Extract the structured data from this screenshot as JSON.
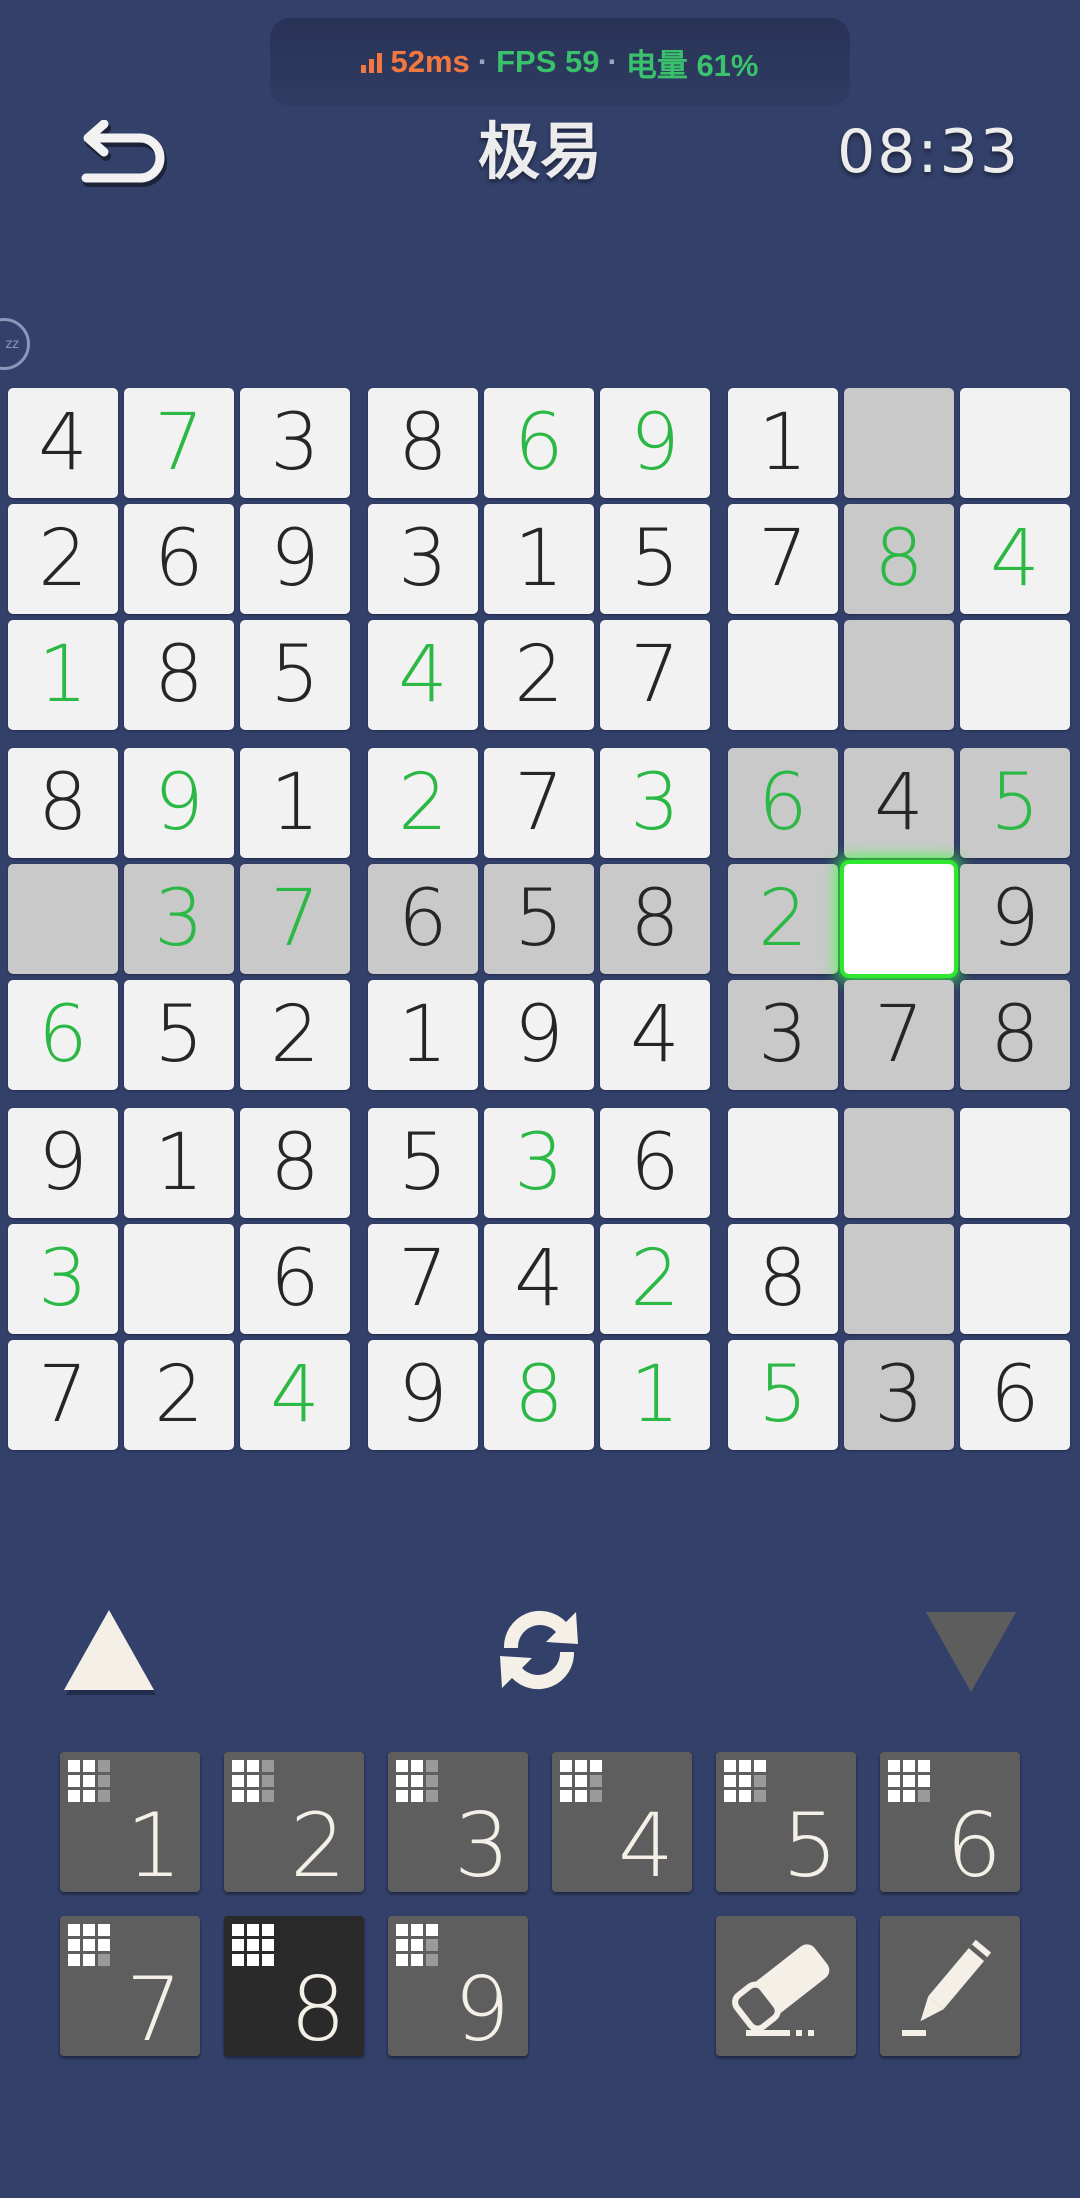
{
  "status_bar": {
    "ping": "52ms",
    "fps": "FPS 59",
    "battery": "电量 61%",
    "separator": "·"
  },
  "header": {
    "title": "极易",
    "timer": "08:33"
  },
  "sleep_badge": {
    "text": "zz"
  },
  "board": {
    "selected": [
      4,
      7
    ],
    "highlighted": [
      [
        0,
        7
      ],
      [
        1,
        7
      ],
      [
        2,
        7
      ],
      [
        3,
        6
      ],
      [
        3,
        7
      ],
      [
        3,
        8
      ],
      [
        4,
        0
      ],
      [
        4,
        1
      ],
      [
        4,
        2
      ],
      [
        4,
        3
      ],
      [
        4,
        4
      ],
      [
        4,
        5
      ],
      [
        4,
        6
      ],
      [
        4,
        8
      ],
      [
        5,
        6
      ],
      [
        5,
        7
      ],
      [
        5,
        8
      ],
      [
        6,
        7
      ],
      [
        7,
        7
      ],
      [
        8,
        7
      ]
    ],
    "cells": [
      [
        {
          "v": "4",
          "g": false
        },
        {
          "v": "7",
          "g": true
        },
        {
          "v": "3",
          "g": false
        },
        {
          "v": "8",
          "g": false
        },
        {
          "v": "6",
          "g": true
        },
        {
          "v": "9",
          "g": true
        },
        {
          "v": "1",
          "g": false
        },
        {
          "v": "",
          "g": false
        },
        {
          "v": "",
          "g": false
        }
      ],
      [
        {
          "v": "2",
          "g": false
        },
        {
          "v": "6",
          "g": false
        },
        {
          "v": "9",
          "g": false
        },
        {
          "v": "3",
          "g": false
        },
        {
          "v": "1",
          "g": false
        },
        {
          "v": "5",
          "g": false
        },
        {
          "v": "7",
          "g": false
        },
        {
          "v": "8",
          "g": true
        },
        {
          "v": "4",
          "g": true
        }
      ],
      [
        {
          "v": "1",
          "g": true
        },
        {
          "v": "8",
          "g": false
        },
        {
          "v": "5",
          "g": false
        },
        {
          "v": "4",
          "g": true
        },
        {
          "v": "2",
          "g": false
        },
        {
          "v": "7",
          "g": false
        },
        {
          "v": "",
          "g": false
        },
        {
          "v": "",
          "g": false
        },
        {
          "v": "",
          "g": false
        }
      ],
      [
        {
          "v": "8",
          "g": false
        },
        {
          "v": "9",
          "g": true
        },
        {
          "v": "1",
          "g": false
        },
        {
          "v": "2",
          "g": true
        },
        {
          "v": "7",
          "g": false
        },
        {
          "v": "3",
          "g": true
        },
        {
          "v": "6",
          "g": true
        },
        {
          "v": "4",
          "g": false
        },
        {
          "v": "5",
          "g": true
        }
      ],
      [
        {
          "v": "",
          "g": false
        },
        {
          "v": "3",
          "g": true
        },
        {
          "v": "7",
          "g": true
        },
        {
          "v": "6",
          "g": false
        },
        {
          "v": "5",
          "g": false
        },
        {
          "v": "8",
          "g": false
        },
        {
          "v": "2",
          "g": true
        },
        {
          "v": "",
          "g": false
        },
        {
          "v": "9",
          "g": false
        }
      ],
      [
        {
          "v": "6",
          "g": true
        },
        {
          "v": "5",
          "g": false
        },
        {
          "v": "2",
          "g": false
        },
        {
          "v": "1",
          "g": false
        },
        {
          "v": "9",
          "g": false
        },
        {
          "v": "4",
          "g": false
        },
        {
          "v": "3",
          "g": false
        },
        {
          "v": "7",
          "g": false
        },
        {
          "v": "8",
          "g": false
        }
      ],
      [
        {
          "v": "9",
          "g": false
        },
        {
          "v": "1",
          "g": false
        },
        {
          "v": "8",
          "g": false
        },
        {
          "v": "5",
          "g": false
        },
        {
          "v": "3",
          "g": true
        },
        {
          "v": "6",
          "g": false
        },
        {
          "v": "",
          "g": false
        },
        {
          "v": "",
          "g": false
        },
        {
          "v": "",
          "g": false
        }
      ],
      [
        {
          "v": "3",
          "g": true
        },
        {
          "v": "",
          "g": false
        },
        {
          "v": "6",
          "g": false
        },
        {
          "v": "7",
          "g": false
        },
        {
          "v": "4",
          "g": false
        },
        {
          "v": "2",
          "g": true
        },
        {
          "v": "8",
          "g": false
        },
        {
          "v": "",
          "g": false
        },
        {
          "v": "",
          "g": false
        }
      ],
      [
        {
          "v": "7",
          "g": false
        },
        {
          "v": "2",
          "g": false
        },
        {
          "v": "4",
          "g": true
        },
        {
          "v": "9",
          "g": false
        },
        {
          "v": "8",
          "g": true
        },
        {
          "v": "1",
          "g": true
        },
        {
          "v": "5",
          "g": true
        },
        {
          "v": "3",
          "g": false
        },
        {
          "v": "6",
          "g": false
        }
      ]
    ]
  },
  "controls": {
    "up_icon": "triangle-up-icon",
    "rotate_icon": "refresh-icon",
    "down_icon": "triangle-down-icon"
  },
  "keypad": {
    "digits": [
      {
        "label": "1",
        "dim": [
          2,
          5,
          8
        ],
        "active": false
      },
      {
        "label": "2",
        "dim": [
          2,
          5,
          8
        ],
        "active": false
      },
      {
        "label": "3",
        "dim": [
          2,
          5,
          8
        ],
        "active": false
      },
      {
        "label": "4",
        "dim": [
          5,
          8
        ],
        "active": false
      },
      {
        "label": "5",
        "dim": [
          5,
          8
        ],
        "active": false
      },
      {
        "label": "6",
        "dim": [
          8
        ],
        "active": false
      },
      {
        "label": "7",
        "dim": [
          8
        ],
        "active": false
      },
      {
        "label": "8",
        "dim": [],
        "active": true
      },
      {
        "label": "9",
        "dim": [
          5,
          8
        ],
        "active": false
      }
    ],
    "eraser_icon": "eraser-icon",
    "pencil_icon": "pencil-icon"
  },
  "colors": {
    "background": "#33406a",
    "given": "#262626",
    "entered": "#2cb845",
    "highlight": "#c9c9ca",
    "selected_glow": "#36ff36"
  }
}
